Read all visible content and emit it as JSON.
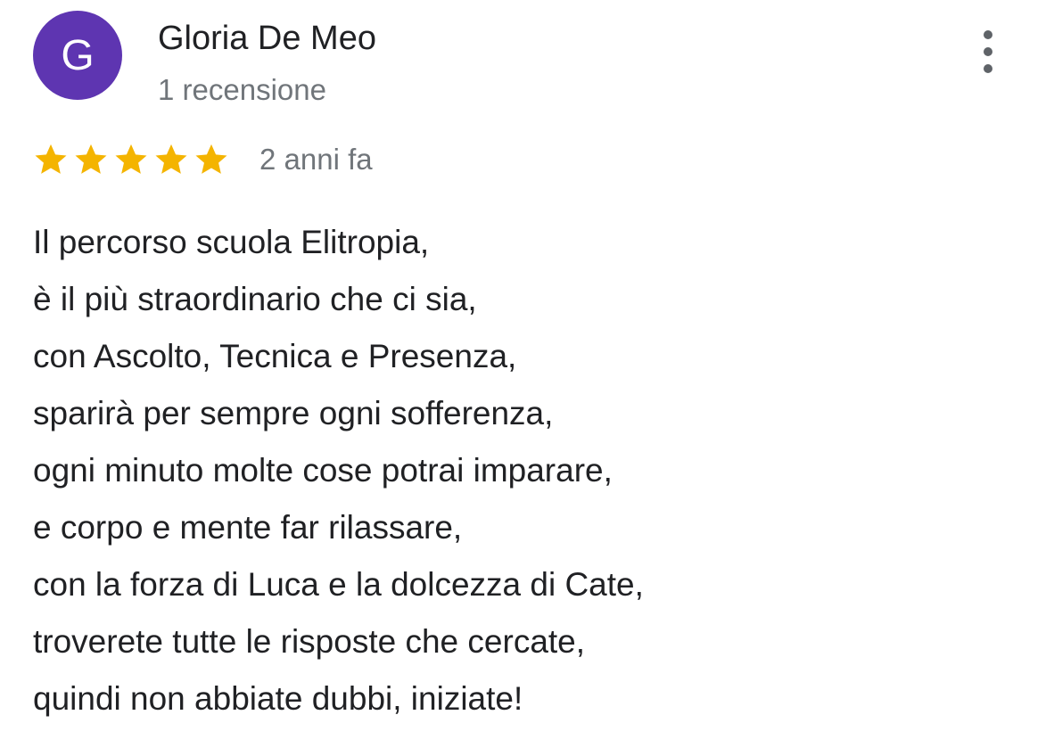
{
  "review": {
    "author": {
      "initial": "G",
      "name": "Gloria De Meo",
      "review_count": "1 recensione",
      "avatar_color": "#5e35b1"
    },
    "menu_icon": "more-vert-icon",
    "rating": {
      "stars": 5,
      "max_stars": 5,
      "star_color": "#f4b400",
      "star_icon": "star-icon"
    },
    "date": "2 anni fa",
    "text_lines": [
      "Il percorso scuola Elitropia,",
      "è il più straordinario che ci sia,",
      "con Ascolto, Tecnica e Presenza,",
      "sparirà per sempre ogni sofferenza,",
      "ogni minuto molte cose potrai imparare,",
      "e corpo e mente far rilassare,",
      "con la forza di Luca e la dolcezza di Cate,",
      "troverete tutte le risposte che cercate,",
      "quindi non abbiate dubbi, iniziate!"
    ]
  }
}
